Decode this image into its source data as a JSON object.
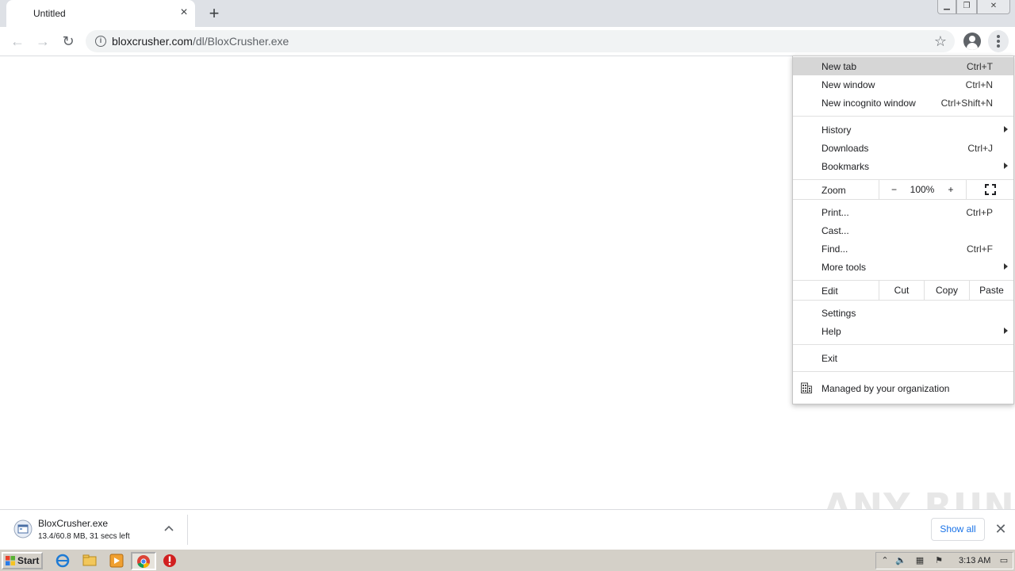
{
  "browser": {
    "tab_title": "Untitled",
    "url_domain": "bloxcrusher.com",
    "url_path": "/dl/BloxCrusher.exe"
  },
  "menu": {
    "new_tab": {
      "label": "New tab",
      "shortcut": "Ctrl+T"
    },
    "new_window": {
      "label": "New window",
      "shortcut": "Ctrl+N"
    },
    "new_incognito": {
      "label": "New incognito window",
      "shortcut": "Ctrl+Shift+N"
    },
    "history": {
      "label": "History"
    },
    "downloads": {
      "label": "Downloads",
      "shortcut": "Ctrl+J"
    },
    "bookmarks": {
      "label": "Bookmarks"
    },
    "zoom": {
      "label": "Zoom",
      "minus": "−",
      "value": "100%",
      "plus": "+"
    },
    "print": {
      "label": "Print...",
      "shortcut": "Ctrl+P"
    },
    "cast": {
      "label": "Cast..."
    },
    "find": {
      "label": "Find...",
      "shortcut": "Ctrl+F"
    },
    "more_tools": {
      "label": "More tools"
    },
    "edit": {
      "label": "Edit",
      "cut": "Cut",
      "copy": "Copy",
      "paste": "Paste"
    },
    "settings": {
      "label": "Settings"
    },
    "help": {
      "label": "Help"
    },
    "exit": {
      "label": "Exit"
    },
    "managed": {
      "label": "Managed by your organization"
    }
  },
  "download": {
    "filename": "BloxCrusher.exe",
    "status": "13.4/60.8 MB, 31 secs left",
    "show_all": "Show all"
  },
  "watermark": "ANY RUN",
  "taskbar": {
    "start": "Start",
    "time": "3:13 AM"
  },
  "colors": {
    "titlebar": "#dee1e6",
    "menu_highlight": "#d6d6d6",
    "link_blue": "#1a73e8",
    "taskbar": "#d4d0c8"
  }
}
